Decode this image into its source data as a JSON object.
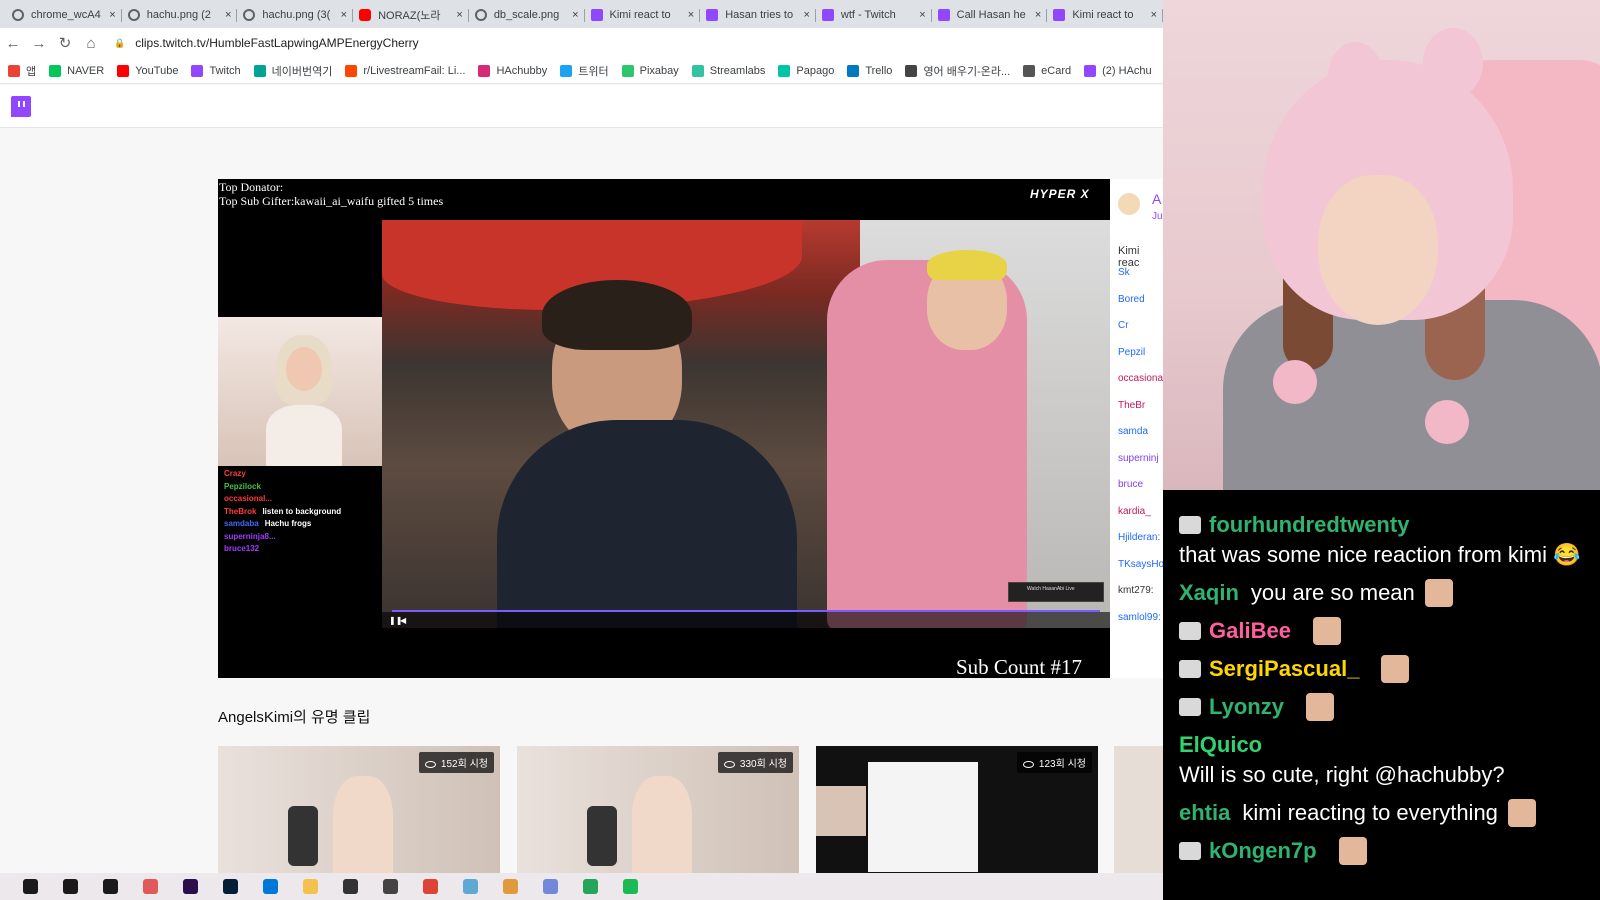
{
  "browser": {
    "tabs": [
      {
        "title": "chrome_wcA4",
        "icon": "globe-icon"
      },
      {
        "title": "hachu.png (2",
        "icon": "globe-icon"
      },
      {
        "title": "hachu.png (3(",
        "icon": "globe-icon"
      },
      {
        "title": "NORAZ(노라",
        "icon": "youtube-icon"
      },
      {
        "title": "db_scale.png",
        "icon": "globe-icon"
      },
      {
        "title": "Kimi react to",
        "icon": "twitch-icon"
      },
      {
        "title": "Hasan tries to",
        "icon": "twitch-icon"
      },
      {
        "title": "wtf - Twitch",
        "icon": "twitch-icon"
      },
      {
        "title": "Call Hasan he",
        "icon": "twitch-icon"
      },
      {
        "title": "Kimi react to",
        "icon": "twitch-icon"
      }
    ],
    "url": "clips.twitch.tv/HumbleFastLapwingAMPEnergyCherry",
    "bookmarks": [
      {
        "label": "앱",
        "color": "#ea4335"
      },
      {
        "label": "NAVER",
        "color": "#03c75a"
      },
      {
        "label": "YouTube",
        "color": "#ff0000"
      },
      {
        "label": "Twitch",
        "color": "#9146ff"
      },
      {
        "label": "네이버번역기",
        "color": "#00a495"
      },
      {
        "label": "r/LivestreamFail: Li...",
        "color": "#ff4500"
      },
      {
        "label": "HAchubby",
        "color": "#d62976"
      },
      {
        "label": "트위터",
        "color": "#1da1f2"
      },
      {
        "label": "Pixabay",
        "color": "#2ec66d"
      },
      {
        "label": "Streamlabs",
        "color": "#31c3a2"
      },
      {
        "label": "Papago",
        "color": "#00c6a7"
      },
      {
        "label": "Trello",
        "color": "#0079bf"
      },
      {
        "label": "영어 배우기-온라...",
        "color": "#444444"
      },
      {
        "label": "eCard",
        "color": "#555555"
      },
      {
        "label": "(2) HAchu",
        "color": "#9146ff"
      }
    ]
  },
  "player": {
    "top_donator": "Top Donator:",
    "top_sub_gifter": "Top Sub Gifter:kawaii_ai_waifu gifted 5 times",
    "brand": "HYPER X",
    "sub_count": "Sub Count #17",
    "mini_chat": [
      {
        "name": "Crazy",
        "text": "",
        "color": "#ff3b3b"
      },
      {
        "name": "Pepzilock",
        "text": "",
        "color": "#43c343"
      },
      {
        "name": "occasional...",
        "text": "",
        "color": "#ff3b3b"
      },
      {
        "name": "TheBrok",
        "text": "listen to background",
        "color": "#ff3b3b"
      },
      {
        "name": "samdaba",
        "text": "Hachu frogs",
        "color": "#3b6bff"
      },
      {
        "name": "superninja8...",
        "text": "",
        "color": "#a23bff"
      },
      {
        "name": "bruce132",
        "text": "",
        "color": "#a23bff"
      }
    ]
  },
  "side_chat": {
    "header_name": "A",
    "header_sub": "Ju",
    "title": "Kimi reac",
    "names": [
      {
        "n": "Sk",
        "c": "#1f69ff"
      },
      {
        "n": "Bored",
        "c": "#1f69ff"
      },
      {
        "n": "Cr",
        "c": "#1f69ff"
      },
      {
        "n": "Pepzil",
        "c": "#1f69ff"
      },
      {
        "n": "occasiona",
        "c": "#c2185b"
      },
      {
        "n": "TheBr",
        "c": "#c2185b"
      },
      {
        "n": "samda",
        "c": "#1f69ff"
      },
      {
        "n": "superninj",
        "c": "#7e3ff2"
      },
      {
        "n": "bruce",
        "c": "#7e3ff2"
      },
      {
        "n": "kardia_",
        "c": "#c2185b"
      },
      {
        "n": "Hjilderan:",
        "c": "#1f69ff"
      },
      {
        "n": "TKsaysHo",
        "c": "#1f69ff"
      },
      {
        "n": "kmt279:",
        "c": "#333"
      },
      {
        "n": "samlol99:",
        "c": "#1f69ff"
      }
    ]
  },
  "clips": {
    "section_title": "AngelsKimi의 유명 클립",
    "items": [
      {
        "views": "152회 시청"
      },
      {
        "views": "330회 시청"
      },
      {
        "views": "123회 시청"
      }
    ]
  },
  "overlay_chat": [
    {
      "name": "fourhundredtwenty",
      "color": "#2fb36f",
      "msg": "that was some nice reaction from kimi 😂",
      "badge": true,
      "wrap": true
    },
    {
      "name": "Xaqin",
      "color": "#2fb36f",
      "msg": "you are so mean",
      "badge": false,
      "emote": true
    },
    {
      "name": "GaliBee",
      "color": "#ff5f9e",
      "msg": "",
      "badge": true,
      "emote": true
    },
    {
      "name": "SergiPascual_",
      "color": "#ffd700",
      "msg": "",
      "badge": true,
      "emote": true
    },
    {
      "name": "Lyonzy",
      "color": "#2fb36f",
      "msg": "",
      "badge": true,
      "emote": true
    },
    {
      "name": "ElQuico",
      "color": "#2fd36f",
      "msg": "Will is so cute, right @hachubby?",
      "badge": false,
      "wrap": false
    },
    {
      "name": "ehtia",
      "color": "#2fb36f",
      "msg": "kimi reacting to everything",
      "badge": false,
      "emote": true
    },
    {
      "name": "kOngen7p",
      "color": "#2fb36f",
      "msg": "",
      "badge": true,
      "emote": true
    }
  ],
  "taskbar": [
    {
      "icon": "windows-icon",
      "color": "#1a1a1a"
    },
    {
      "icon": "search-icon",
      "color": "#1a1a1a"
    },
    {
      "icon": "task-view-icon",
      "color": "#1a1a1a"
    },
    {
      "icon": "paint-icon",
      "color": "#e05a5a"
    },
    {
      "icon": "premiere-icon",
      "color": "#2b0f4b"
    },
    {
      "icon": "photoshop-icon",
      "color": "#001e36"
    },
    {
      "icon": "edge-icon",
      "color": "#0078d7"
    },
    {
      "icon": "explorer-icon",
      "color": "#f2c14e"
    },
    {
      "icon": "store-icon",
      "color": "#333333"
    },
    {
      "icon": "mail-icon",
      "color": "#444444"
    },
    {
      "icon": "chrome-icon",
      "color": "#db4437"
    },
    {
      "icon": "app-icon",
      "color": "#5fa8d3"
    },
    {
      "icon": "palette-icon",
      "color": "#e09a3c"
    },
    {
      "icon": "discord-icon",
      "color": "#7289da"
    },
    {
      "icon": "kakao-icon",
      "color": "#23a55a"
    },
    {
      "icon": "green-app-icon",
      "color": "#1db954"
    }
  ]
}
